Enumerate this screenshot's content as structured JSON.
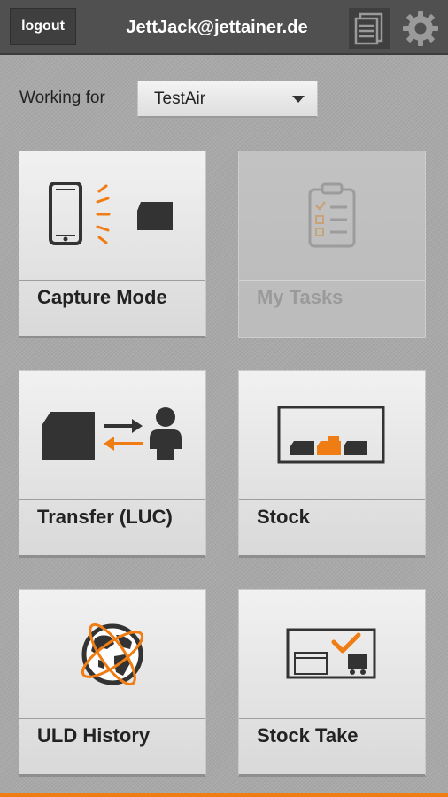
{
  "header": {
    "logout_label": "logout",
    "user_email": "JettJack@jettainer.de",
    "icons": [
      "list-icon",
      "gear-icon"
    ]
  },
  "working_for": {
    "label": "Working for",
    "selected": "TestAir"
  },
  "tiles": [
    {
      "label": "Capture Mode",
      "icon": "capture-icon",
      "enabled": true
    },
    {
      "label": "My Tasks",
      "icon": "clipboard-icon",
      "enabled": false
    },
    {
      "label": "Transfer (LUC)",
      "icon": "transfer-icon",
      "enabled": true
    },
    {
      "label": "Stock",
      "icon": "stock-icon",
      "enabled": true
    },
    {
      "label": "ULD History",
      "icon": "globe-icon",
      "enabled": true
    },
    {
      "label": "Stock Take",
      "icon": "stock-take-icon",
      "enabled": true
    }
  ],
  "colors": {
    "accent": "#f07d14",
    "header_bg": "#505050",
    "icon_dark": "#333333"
  }
}
